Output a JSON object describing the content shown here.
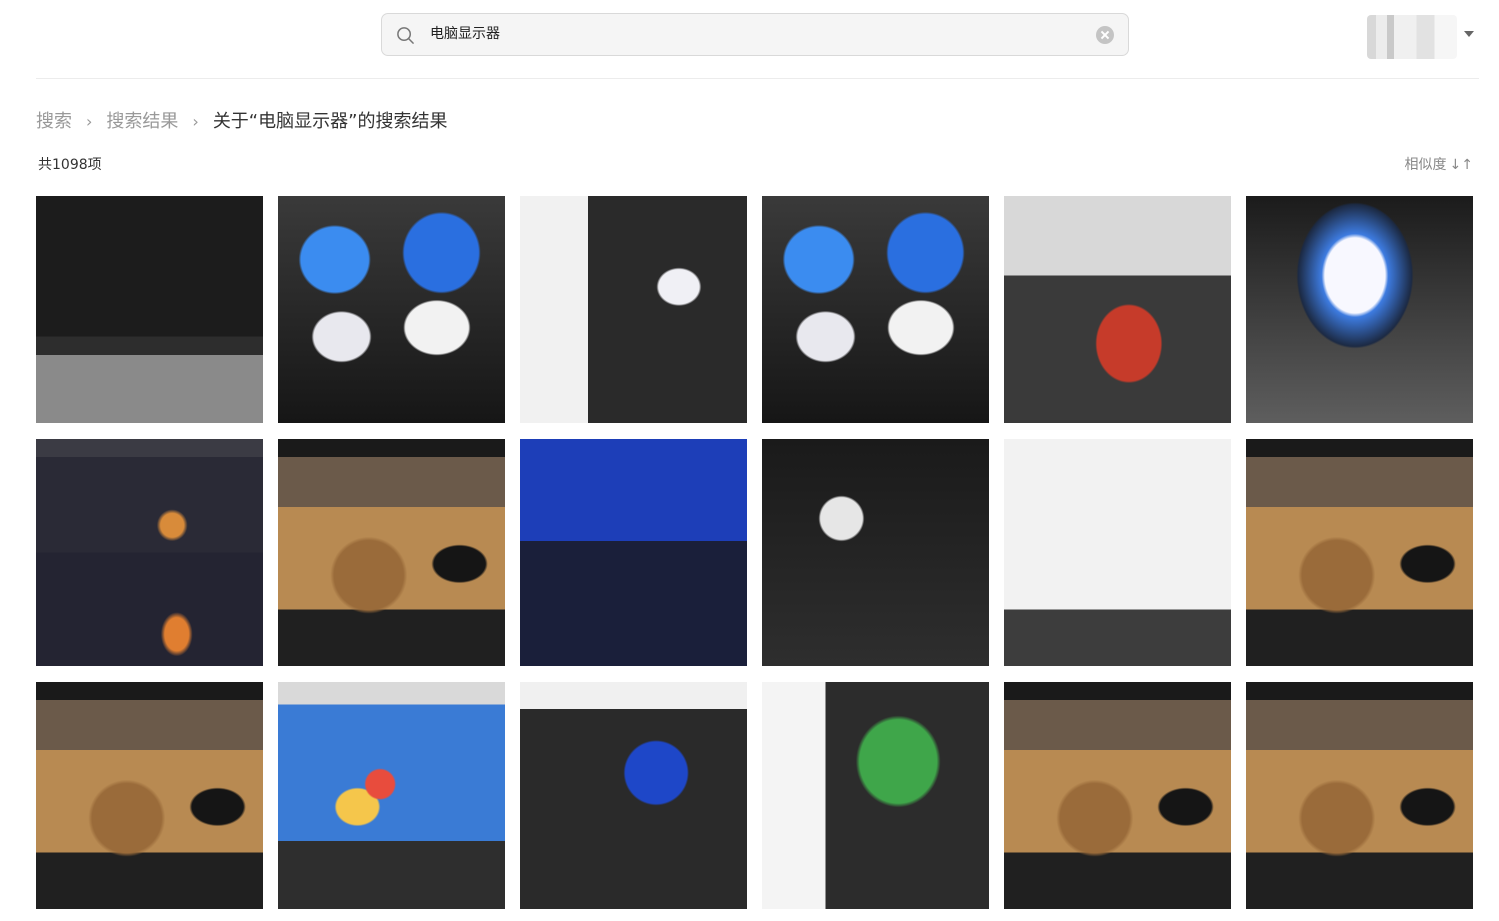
{
  "search": {
    "query": "电脑显示器",
    "icon": "search-icon",
    "clear_icon": "clear-icon"
  },
  "user": {
    "avatar": "avatar",
    "menu_icon": "caret-down-icon"
  },
  "breadcrumb": {
    "items": [
      "搜索",
      "搜索结果"
    ],
    "separator": "›",
    "current": "关于“电脑显示器”的搜索结果"
  },
  "results": {
    "count_label": "共1098项",
    "sort_label": "相似度",
    "sort_icon": "↓↑"
  },
  "thumbnails": [
    {
      "kind": "dark-monitor"
    },
    {
      "kind": "four-screens"
    },
    {
      "kind": "dim-monitor"
    },
    {
      "kind": "four-screens"
    },
    {
      "kind": "ubuntu-small-monitor"
    },
    {
      "kind": "white-screen-monitor"
    },
    {
      "kind": "dual-laptop-galaxy"
    },
    {
      "kind": "beer-wallpaper"
    },
    {
      "kind": "blue-bios"
    },
    {
      "kind": "dark-dialog"
    },
    {
      "kind": "blurry-white"
    },
    {
      "kind": "beer-wallpaper"
    },
    {
      "kind": "beer-wallpaper"
    },
    {
      "kind": "colorful-game"
    },
    {
      "kind": "blue-window"
    },
    {
      "kind": "green-grass"
    },
    {
      "kind": "beer-wallpaper"
    },
    {
      "kind": "beer-wallpaper"
    }
  ]
}
